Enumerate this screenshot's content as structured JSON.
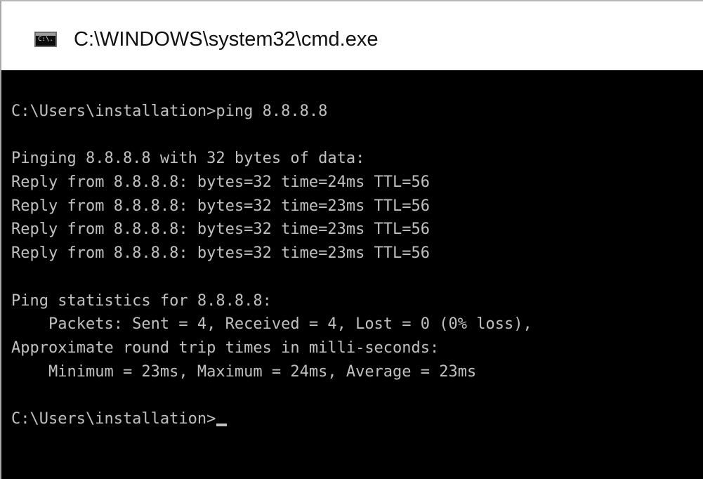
{
  "window": {
    "title": "C:\\WINDOWS\\system32\\cmd.exe",
    "icon": "command-prompt-icon",
    "icon_text": "C:\\."
  },
  "console": {
    "lines": [
      "C:\\Users\\installation>ping 8.8.8.8",
      "",
      "Pinging 8.8.8.8 with 32 bytes of data:",
      "Reply from 8.8.8.8: bytes=32 time=24ms TTL=56",
      "Reply from 8.8.8.8: bytes=32 time=23ms TTL=56",
      "Reply from 8.8.8.8: bytes=32 time=23ms TTL=56",
      "Reply from 8.8.8.8: bytes=32 time=23ms TTL=56",
      "",
      "Ping statistics for 8.8.8.8:",
      "    Packets: Sent = 4, Received = 4, Lost = 0 (0% loss),",
      "Approximate round trip times in milli-seconds:",
      "    Minimum = 23ms, Maximum = 24ms, Average = 23ms",
      "",
      "C:\\Users\\installation>"
    ],
    "text_color": "#c0c0c0",
    "background_color": "#000000"
  }
}
